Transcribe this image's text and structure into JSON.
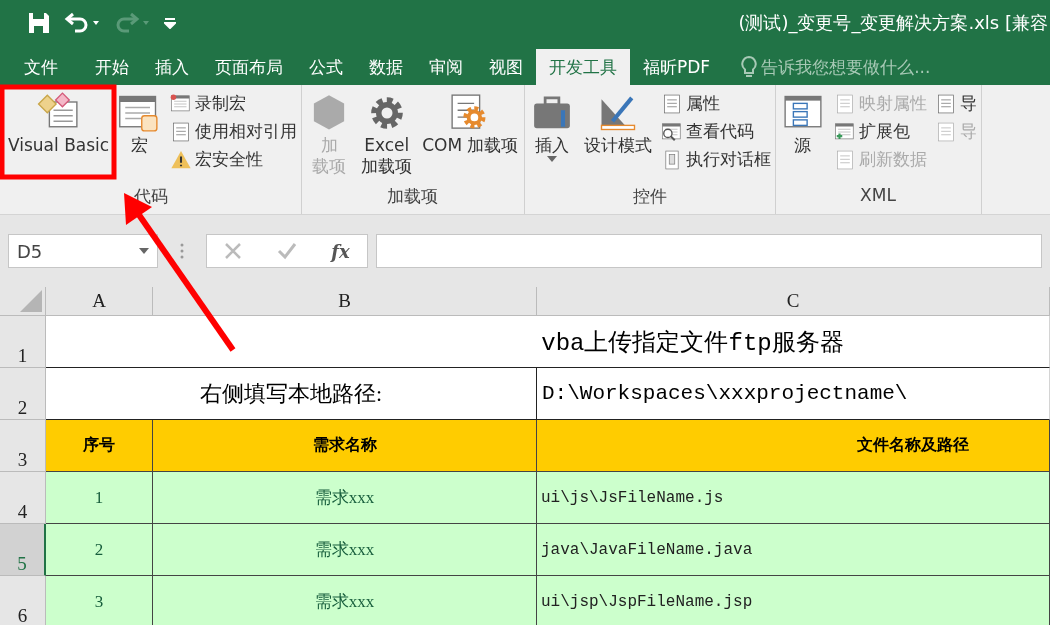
{
  "window": {
    "title": "(测试)_变更号_变更解决方案.xls  [兼容"
  },
  "tabs": [
    {
      "label": "文件",
      "selected": false
    },
    {
      "label": "开始",
      "selected": false
    },
    {
      "label": "插入",
      "selected": false
    },
    {
      "label": "页面布局",
      "selected": false
    },
    {
      "label": "公式",
      "selected": false
    },
    {
      "label": "数据",
      "selected": false
    },
    {
      "label": "审阅",
      "selected": false
    },
    {
      "label": "视图",
      "selected": false
    },
    {
      "label": "开发工具",
      "selected": true
    },
    {
      "label": "福昕PDF",
      "selected": false
    }
  ],
  "tell_me": {
    "placeholder": "告诉我您想要做什么..."
  },
  "ribbon": [
    {
      "label": "代码",
      "items": [
        {
          "kind": "large",
          "lines": [
            "Visual Basic"
          ],
          "disabled": false
        },
        {
          "kind": "large",
          "lines": [
            "宏"
          ],
          "disabled": false
        },
        {
          "kind": "stack",
          "buttons": [
            {
              "label": "录制宏",
              "disabled": false
            },
            {
              "label": "使用相对引用",
              "disabled": false
            },
            {
              "label": "宏安全性",
              "disabled": false
            }
          ]
        }
      ]
    },
    {
      "label": "加载项",
      "items": [
        {
          "kind": "large",
          "lines": [
            "加",
            "载项"
          ],
          "disabled": true
        },
        {
          "kind": "large",
          "lines": [
            "Excel",
            "加载项"
          ],
          "disabled": false
        },
        {
          "kind": "large",
          "lines": [
            "COM 加载项"
          ],
          "disabled": false
        }
      ]
    },
    {
      "label": "控件",
      "items": [
        {
          "kind": "large",
          "lines": [
            "插入"
          ],
          "disabled": false,
          "dropdown": true
        },
        {
          "kind": "large",
          "lines": [
            "设计模式"
          ],
          "disabled": false
        },
        {
          "kind": "stack",
          "buttons": [
            {
              "label": "属性",
              "disabled": false
            },
            {
              "label": "查看代码",
              "disabled": false
            },
            {
              "label": "执行对话框",
              "disabled": false
            }
          ]
        }
      ]
    },
    {
      "label": "XML",
      "items": [
        {
          "kind": "large",
          "lines": [
            "源"
          ],
          "disabled": false
        },
        {
          "kind": "stack",
          "buttons": [
            {
              "label": "映射属性",
              "disabled": true
            },
            {
              "label": "扩展包",
              "disabled": false
            },
            {
              "label": "刷新数据",
              "disabled": true
            }
          ]
        },
        {
          "kind": "stack",
          "buttons": [
            {
              "label": "导",
              "disabled": false
            },
            {
              "label": "导",
              "disabled": true
            }
          ]
        }
      ]
    }
  ],
  "name_box": {
    "value": "D5"
  },
  "formula_bar": {
    "fx": "fx"
  },
  "columns": [
    {
      "label": "A",
      "selected": false
    },
    {
      "label": "B",
      "selected": false
    },
    {
      "label": "C",
      "selected": false
    }
  ],
  "rows": [
    {
      "header": "1",
      "selected": false,
      "kind": "title",
      "cells": [
        "vba上传指定文件ftp服务器"
      ]
    },
    {
      "header": "2",
      "selected": false,
      "kind": "path",
      "cells": [
        "右侧填写本地路径:",
        "D:\\Workspaces\\xxxprojectname\\"
      ]
    },
    {
      "header": "3",
      "selected": false,
      "kind": "head",
      "cells": [
        "序号",
        "需求名称",
        "文件名称及路径"
      ]
    },
    {
      "header": "4",
      "selected": false,
      "kind": "data",
      "cells": [
        "1",
        "需求xxx",
        "ui\\js\\JsFileName.js"
      ]
    },
    {
      "header": "5",
      "selected": true,
      "kind": "data",
      "cells": [
        "2",
        "需求xxx",
        "java\\JavaFileName.java"
      ]
    },
    {
      "header": "6",
      "selected": false,
      "kind": "data",
      "cells": [
        "3",
        "需求xxx",
        "ui\\jsp\\JspFileName.jsp"
      ]
    }
  ]
}
